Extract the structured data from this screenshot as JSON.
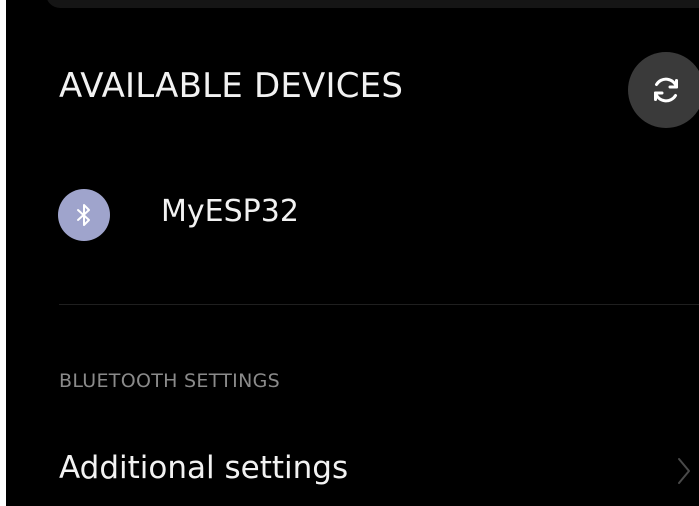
{
  "available_devices": {
    "title": "AVAILABLE DEVICES",
    "refresh_icon": "refresh-icon",
    "devices": [
      {
        "name": "MyESP32",
        "icon": "bluetooth-icon",
        "icon_bg": "#9fa4cc"
      }
    ]
  },
  "bluetooth_settings": {
    "heading": "BLUETOOTH SETTINGS",
    "items": [
      {
        "label": "Additional settings",
        "icon": "chevron-right-icon"
      }
    ]
  },
  "colors": {
    "background": "#000000",
    "text_primary": "#f2f2f2",
    "text_secondary": "#8a8a8a",
    "button_bg": "#3a3a3a"
  }
}
